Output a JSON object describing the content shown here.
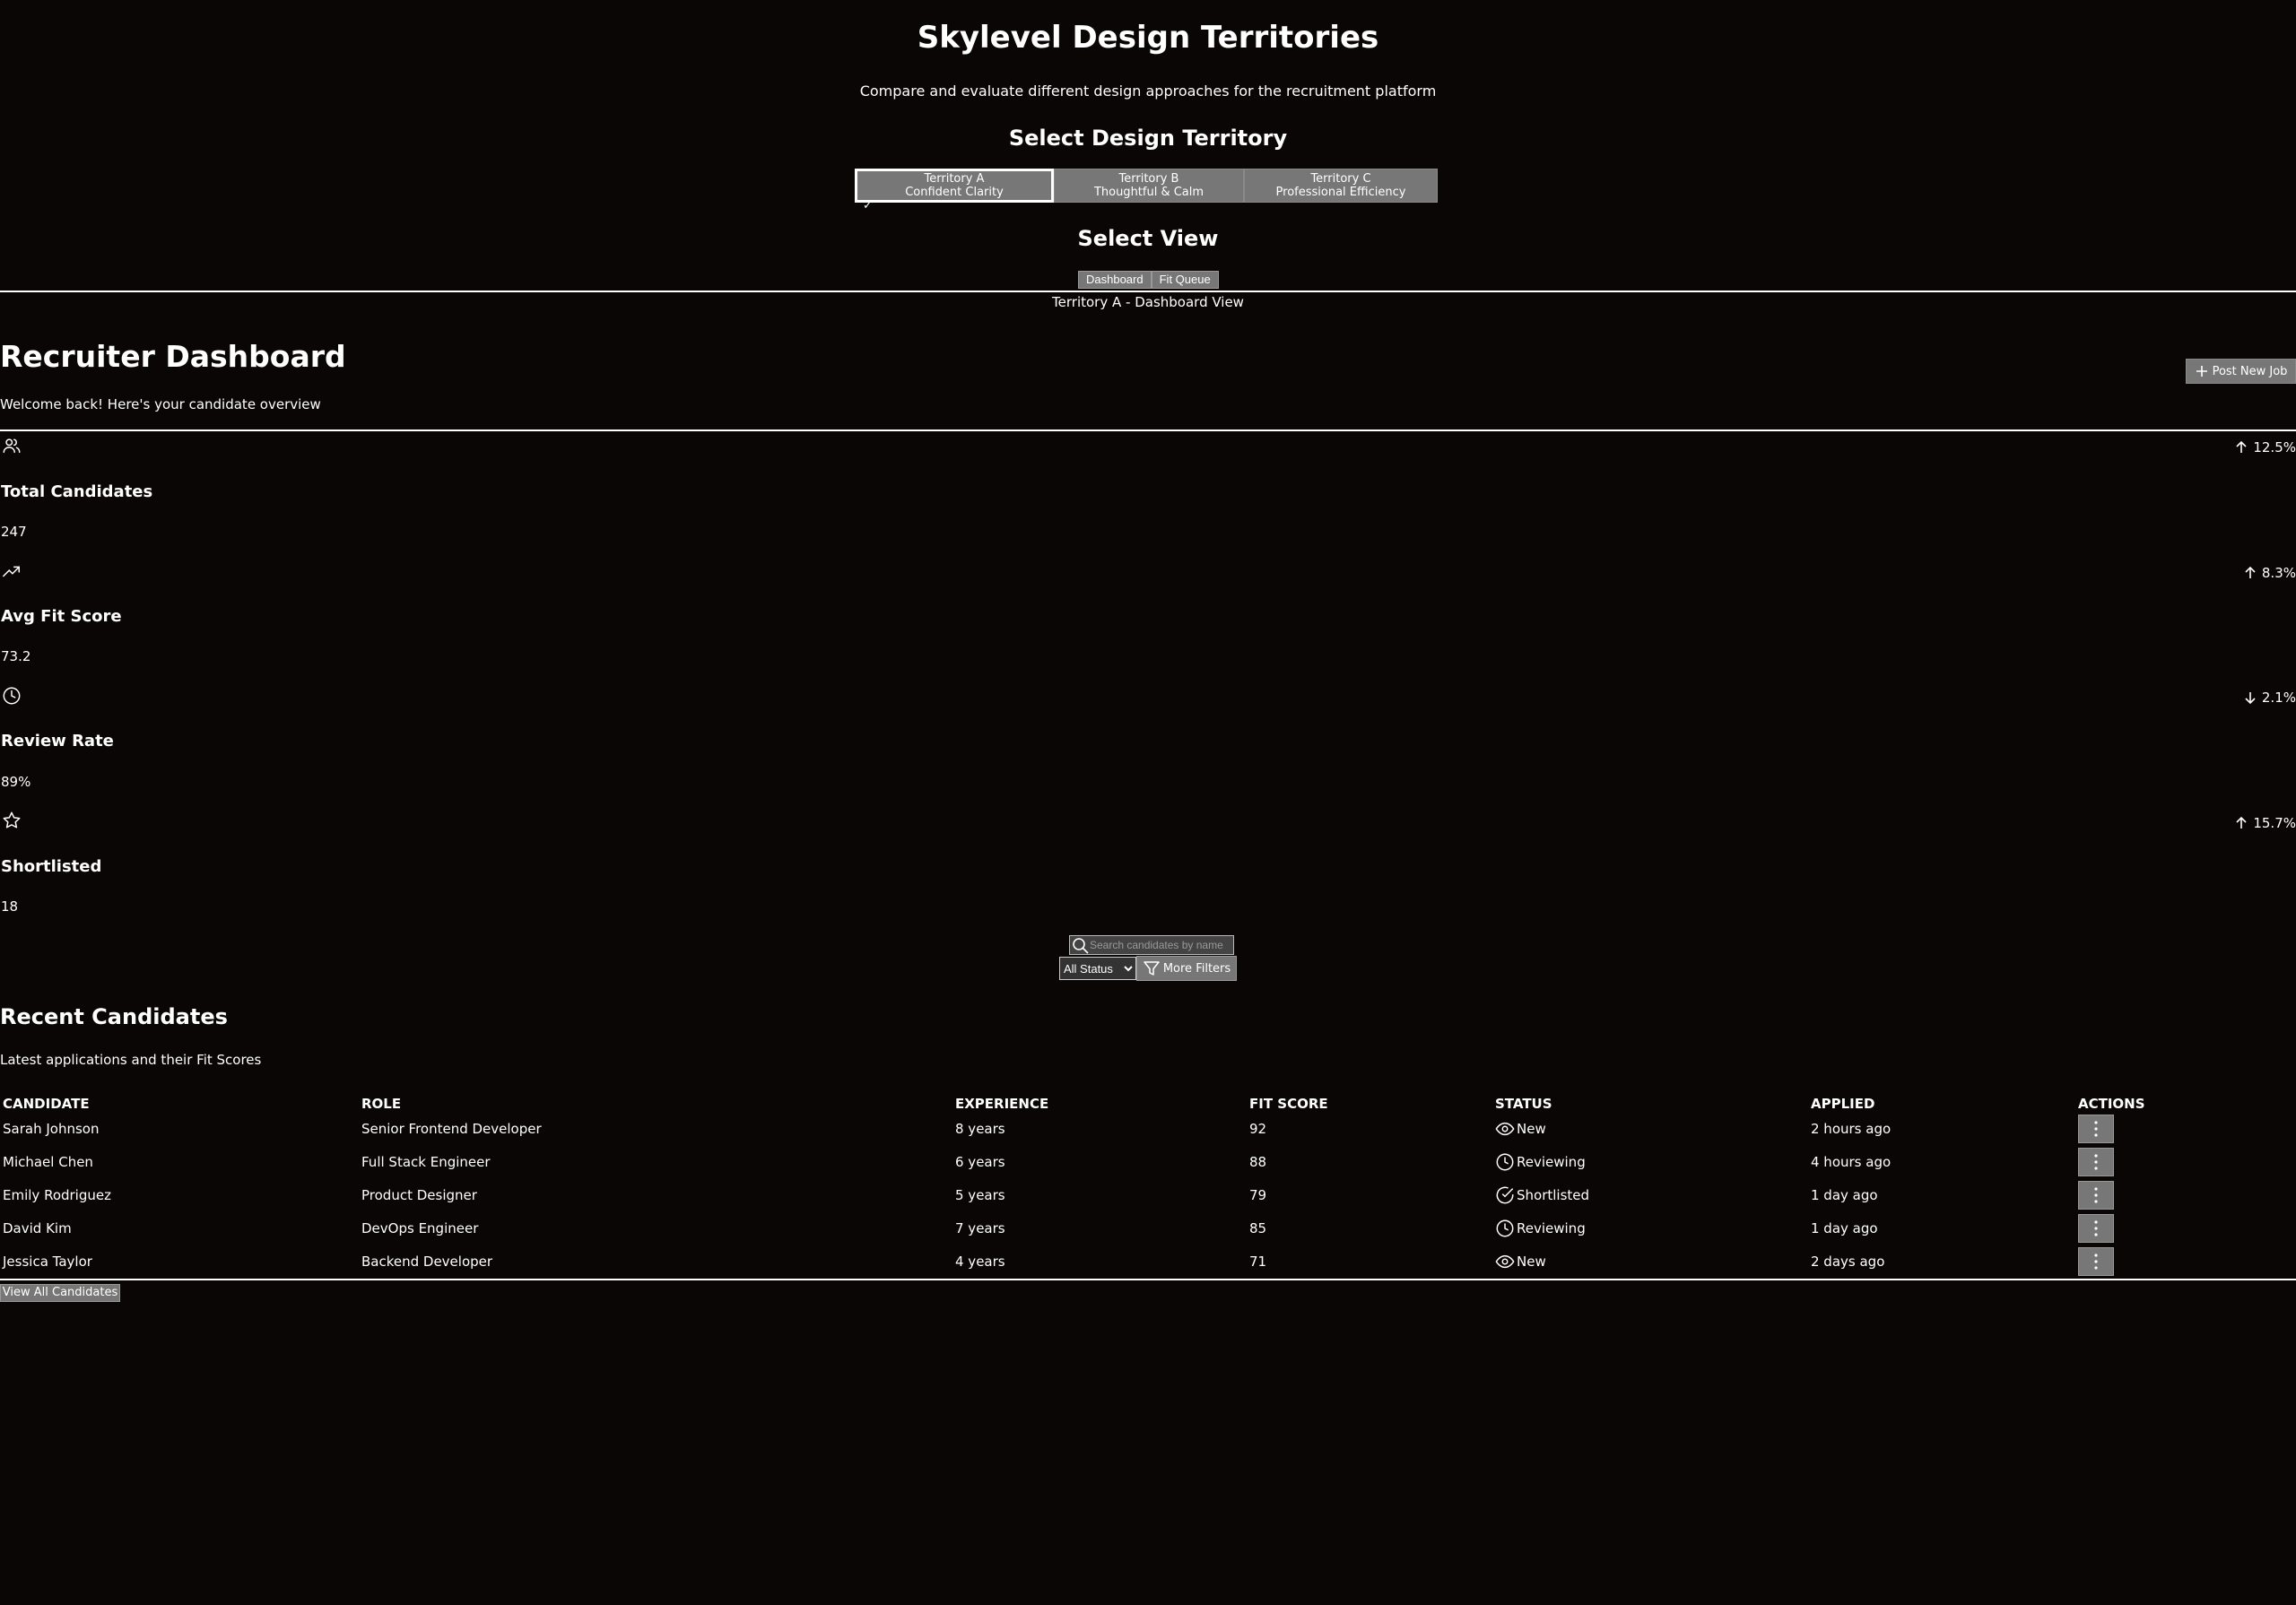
{
  "header": {
    "title": "Skylevel Design Territories",
    "subtitle": "Compare and evaluate different design approaches for the recruitment platform",
    "territory_heading": "Select Design Territory",
    "view_heading": "Select View"
  },
  "territories": [
    {
      "line1": "Territory A",
      "line2": "Confident Clarity",
      "active": true
    },
    {
      "line1": "Territory B",
      "line2": "Thoughtful & Calm",
      "active": false
    },
    {
      "line1": "Territory C",
      "line2": "Professional Efficiency",
      "active": false
    }
  ],
  "active_check": "✓",
  "views": [
    {
      "label": "Dashboard"
    },
    {
      "label": "Fit Queue"
    }
  ],
  "view_caption": "Territory A - Dashboard View",
  "dashboard": {
    "title": "Recruiter Dashboard",
    "welcome": "Welcome back! Here's your candidate overview",
    "post_button": "Post New Job"
  },
  "stats": [
    {
      "icon": "users-icon",
      "label": "Total Candidates",
      "value": "247",
      "change": "12.5%",
      "direction": "up"
    },
    {
      "icon": "trending-up-icon",
      "label": "Avg Fit Score",
      "value": "73.2",
      "change": "8.3%",
      "direction": "up"
    },
    {
      "icon": "clock-icon",
      "label": "Review Rate",
      "value": "89%",
      "change": "2.1%",
      "direction": "down"
    },
    {
      "icon": "star-icon",
      "label": "Shortlisted",
      "value": "18",
      "change": "15.7%",
      "direction": "up"
    }
  ],
  "filters": {
    "search_placeholder": "Search candidates by name, role...",
    "status_selected": "All Status",
    "more_filters": "More Filters"
  },
  "recent": {
    "title": "Recent Candidates",
    "subtitle": "Latest applications and their Fit Scores",
    "columns": [
      "CANDIDATE",
      "ROLE",
      "EXPERIENCE",
      "FIT SCORE",
      "STATUS",
      "APPLIED",
      "ACTIONS"
    ],
    "rows": [
      {
        "name": "Sarah Johnson",
        "role": "Senior Frontend Developer",
        "experience": "8 years",
        "fit": "92",
        "status": "New",
        "status_icon": "eye-icon",
        "applied": "2 hours ago"
      },
      {
        "name": "Michael Chen",
        "role": "Full Stack Engineer",
        "experience": "6 years",
        "fit": "88",
        "status": "Reviewing",
        "status_icon": "clock-icon",
        "applied": "4 hours ago"
      },
      {
        "name": "Emily Rodriguez",
        "role": "Product Designer",
        "experience": "5 years",
        "fit": "79",
        "status": "Shortlisted",
        "status_icon": "check-circle-icon",
        "applied": "1 day ago"
      },
      {
        "name": "David Kim",
        "role": "DevOps Engineer",
        "experience": "7 years",
        "fit": "85",
        "status": "Reviewing",
        "status_icon": "clock-icon",
        "applied": "1 day ago"
      },
      {
        "name": "Jessica Taylor",
        "role": "Backend Developer",
        "experience": "4 years",
        "fit": "71",
        "status": "New",
        "status_icon": "eye-icon",
        "applied": "2 days ago"
      }
    ],
    "view_all": "View All Candidates"
  }
}
